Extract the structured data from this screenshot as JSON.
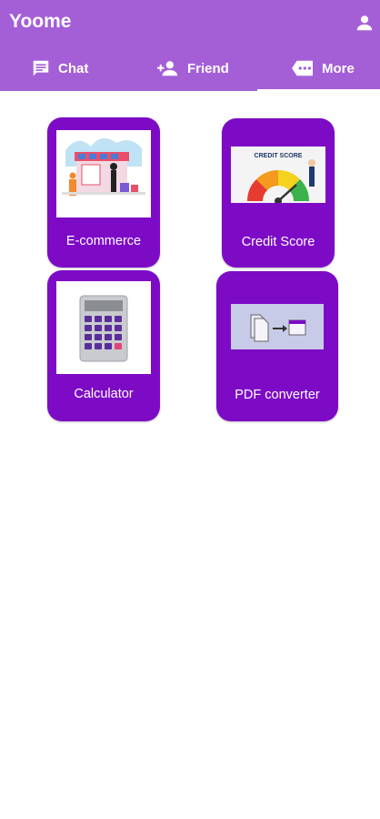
{
  "app": {
    "title": "Yoome"
  },
  "tabs": [
    {
      "label": "Chat",
      "icon": "chat-icon"
    },
    {
      "label": "Friend",
      "icon": "add-person-icon"
    },
    {
      "label": "More",
      "icon": "more-icon",
      "selected": true
    }
  ],
  "cards": [
    {
      "label": "E-commerce",
      "image": "ecommerce-illustration"
    },
    {
      "label": "Credit Score",
      "image": "credit-score-gauge",
      "image_text": "CREDIT SCORE"
    },
    {
      "label": "Calculator",
      "image": "calculator-illustration"
    },
    {
      "label": "PDF converter",
      "image": "pdf-converter-illustration"
    }
  ],
  "colors": {
    "header": "#a45fd6",
    "card": "#7d0bc6",
    "text_on_primary": "#ffffff"
  }
}
